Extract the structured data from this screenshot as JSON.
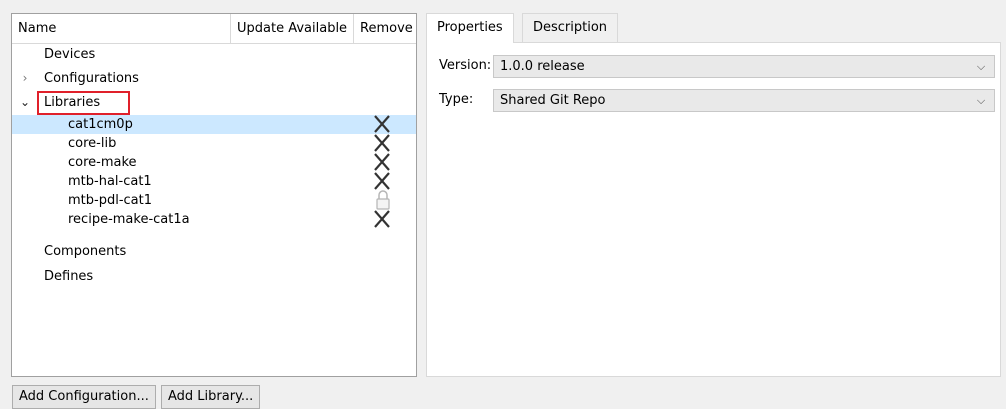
{
  "tree": {
    "columns": {
      "name": "Name",
      "update": "Update Available",
      "remove": "Remove"
    },
    "nodes": {
      "devices": "Devices",
      "configurations": "Configurations",
      "libraries": "Libraries",
      "components": "Components",
      "defines": "Defines"
    },
    "libraries": [
      {
        "label": "cat1cm0p",
        "action": "remove-icon",
        "selected": true
      },
      {
        "label": "core-lib",
        "action": "remove-icon"
      },
      {
        "label": "core-make",
        "action": "remove-icon"
      },
      {
        "label": "mtb-hal-cat1",
        "action": "remove-icon"
      },
      {
        "label": "mtb-pdl-cat1",
        "action": "lock-icon"
      },
      {
        "label": "recipe-make-cat1a",
        "action": "remove-icon"
      }
    ]
  },
  "tabs": {
    "properties": "Properties",
    "description": "Description"
  },
  "properties": {
    "version_label": "Version:",
    "version_value": "1.0.0 release",
    "type_label": "Type:",
    "type_value": "Shared Git Repo"
  },
  "buttons": {
    "add_configuration": "Add Configuration...",
    "add_library": "Add Library..."
  },
  "colors": {
    "selection": "#cce8ff",
    "highlight": "#e0202a"
  }
}
